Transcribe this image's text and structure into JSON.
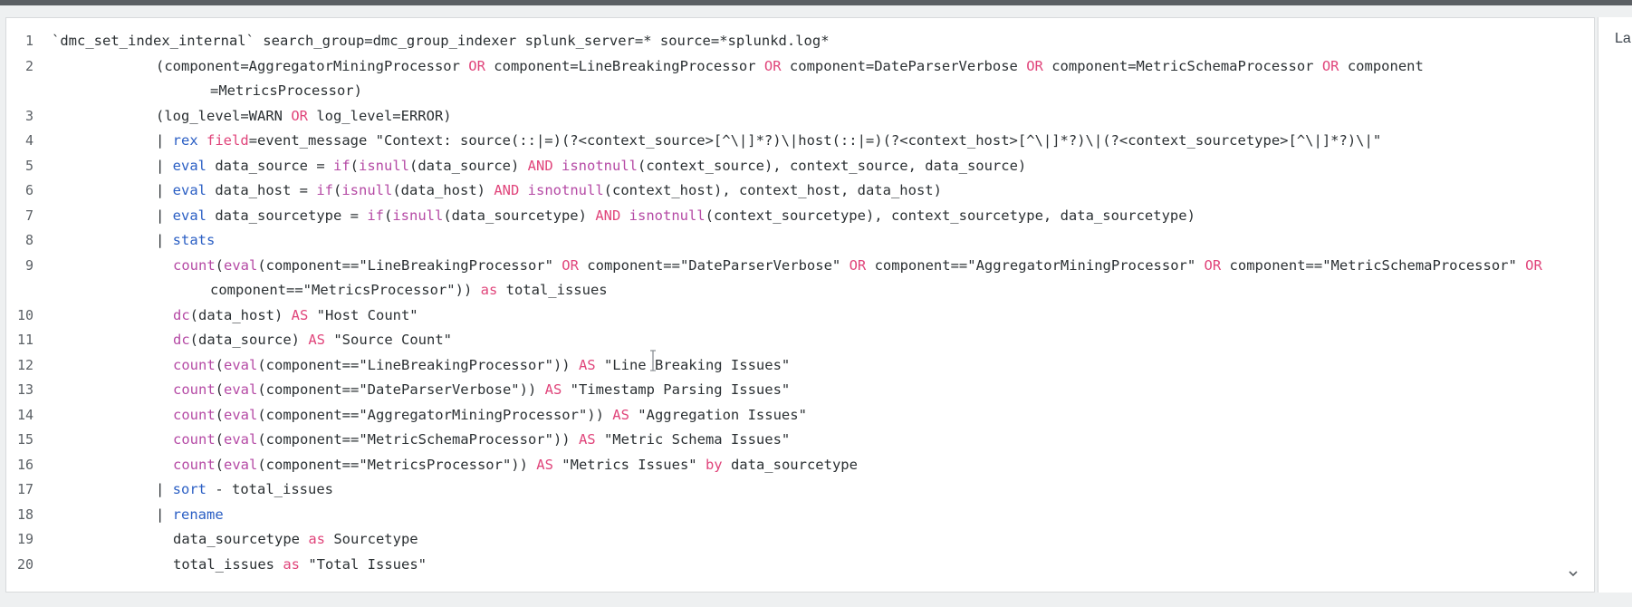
{
  "side_panel": {
    "label": "La"
  },
  "lines": [
    {
      "n": "1",
      "indent": 0,
      "wrap": false,
      "segs": [
        [
          "t",
          "`dmc_set_index_internal` search_group=dmc_group_indexer splunk_server=* source=*splunkd.log*"
        ]
      ]
    },
    {
      "n": "2",
      "indent": 1,
      "wrap": false,
      "segs": [
        [
          "t",
          "(component=AggregatorMiningProcessor "
        ],
        [
          "kw",
          "OR"
        ],
        [
          "t",
          " component=LineBreakingProcessor "
        ],
        [
          "kw",
          "OR"
        ],
        [
          "t",
          " component=DateParserVerbose "
        ],
        [
          "kw",
          "OR"
        ],
        [
          "t",
          " component=MetricSchemaProcessor "
        ],
        [
          "kw",
          "OR"
        ],
        [
          "t",
          " component"
        ]
      ]
    },
    {
      "n": "",
      "indent": 3,
      "wrap": true,
      "segs": [
        [
          "t",
          "=MetricsProcessor)"
        ]
      ]
    },
    {
      "n": "3",
      "indent": 1,
      "wrap": false,
      "segs": [
        [
          "t",
          "(log_level=WARN "
        ],
        [
          "kw",
          "OR"
        ],
        [
          "t",
          " log_level=ERROR)"
        ]
      ]
    },
    {
      "n": "4",
      "indent": 1,
      "wrap": false,
      "segs": [
        [
          "t",
          "| "
        ],
        [
          "cmd",
          "rex"
        ],
        [
          "t",
          " "
        ],
        [
          "kw",
          "field"
        ],
        [
          "t",
          "=event_message \"Context: source(::|=)(?<context_source>[^\\|]*?)\\|host(::|=)(?<context_host>[^\\|]*?)\\|(?<context_sourcetype>[^\\|]*?)\\|\""
        ]
      ]
    },
    {
      "n": "5",
      "indent": 1,
      "wrap": false,
      "segs": [
        [
          "t",
          "| "
        ],
        [
          "cmd",
          "eval"
        ],
        [
          "t",
          " data_source = "
        ],
        [
          "fn",
          "if"
        ],
        [
          "t",
          "("
        ],
        [
          "fn",
          "isnull"
        ],
        [
          "t",
          "(data_source) "
        ],
        [
          "kw",
          "AND"
        ],
        [
          "t",
          " "
        ],
        [
          "fn",
          "isnotnull"
        ],
        [
          "t",
          "(context_source), context_source, data_source)"
        ]
      ]
    },
    {
      "n": "6",
      "indent": 1,
      "wrap": false,
      "segs": [
        [
          "t",
          "| "
        ],
        [
          "cmd",
          "eval"
        ],
        [
          "t",
          " data_host = "
        ],
        [
          "fn",
          "if"
        ],
        [
          "t",
          "("
        ],
        [
          "fn",
          "isnull"
        ],
        [
          "t",
          "(data_host) "
        ],
        [
          "kw",
          "AND"
        ],
        [
          "t",
          " "
        ],
        [
          "fn",
          "isnotnull"
        ],
        [
          "t",
          "(context_host), context_host, data_host)"
        ]
      ]
    },
    {
      "n": "7",
      "indent": 1,
      "wrap": false,
      "segs": [
        [
          "t",
          "| "
        ],
        [
          "cmd",
          "eval"
        ],
        [
          "t",
          " data_sourcetype = "
        ],
        [
          "fn",
          "if"
        ],
        [
          "t",
          "("
        ],
        [
          "fn",
          "isnull"
        ],
        [
          "t",
          "(data_sourcetype) "
        ],
        [
          "kw",
          "AND"
        ],
        [
          "t",
          " "
        ],
        [
          "fn",
          "isnotnull"
        ],
        [
          "t",
          "(context_sourcetype), context_sourcetype, data_sourcetype)"
        ]
      ]
    },
    {
      "n": "8",
      "indent": 1,
      "wrap": false,
      "segs": [
        [
          "t",
          "| "
        ],
        [
          "cmd",
          "stats"
        ]
      ]
    },
    {
      "n": "9",
      "indent": 2,
      "wrap": false,
      "segs": [
        [
          "fn",
          "count"
        ],
        [
          "t",
          "("
        ],
        [
          "fn",
          "eval"
        ],
        [
          "t",
          "(component==\"LineBreakingProcessor\" "
        ],
        [
          "kw",
          "OR"
        ],
        [
          "t",
          " component==\"DateParserVerbose\" "
        ],
        [
          "kw",
          "OR"
        ],
        [
          "t",
          " component==\"AggregatorMiningProcessor\" "
        ],
        [
          "kw",
          "OR"
        ],
        [
          "t",
          " component==\"MetricSchemaProcessor\" "
        ],
        [
          "kw",
          "OR"
        ]
      ]
    },
    {
      "n": "",
      "indent": 3,
      "wrap": true,
      "segs": [
        [
          "t",
          "component==\"MetricsProcessor\")) "
        ],
        [
          "kw",
          "as"
        ],
        [
          "t",
          " total_issues"
        ]
      ]
    },
    {
      "n": "10",
      "indent": 2,
      "wrap": false,
      "segs": [
        [
          "fn",
          "dc"
        ],
        [
          "t",
          "(data_host) "
        ],
        [
          "kw",
          "AS"
        ],
        [
          "t",
          " \"Host Count\""
        ]
      ]
    },
    {
      "n": "11",
      "indent": 2,
      "wrap": false,
      "segs": [
        [
          "fn",
          "dc"
        ],
        [
          "t",
          "(data_source) "
        ],
        [
          "kw",
          "AS"
        ],
        [
          "t",
          " \"Source Count\""
        ]
      ]
    },
    {
      "n": "12",
      "indent": 2,
      "wrap": false,
      "segs": [
        [
          "fn",
          "count"
        ],
        [
          "t",
          "("
        ],
        [
          "fn",
          "eval"
        ],
        [
          "t",
          "(component==\"LineBreakingProcessor\")) "
        ],
        [
          "kw",
          "AS"
        ],
        [
          "t",
          " \"Line Breaking Issues\""
        ]
      ]
    },
    {
      "n": "13",
      "indent": 2,
      "wrap": false,
      "segs": [
        [
          "fn",
          "count"
        ],
        [
          "t",
          "("
        ],
        [
          "fn",
          "eval"
        ],
        [
          "t",
          "(component==\"DateParserVerbose\")) "
        ],
        [
          "kw",
          "AS"
        ],
        [
          "t",
          " \"Timestamp Parsing Issues\""
        ]
      ]
    },
    {
      "n": "14",
      "indent": 2,
      "wrap": false,
      "segs": [
        [
          "fn",
          "count"
        ],
        [
          "t",
          "("
        ],
        [
          "fn",
          "eval"
        ],
        [
          "t",
          "(component==\"AggregatorMiningProcessor\")) "
        ],
        [
          "kw",
          "AS"
        ],
        [
          "t",
          " \"Aggregation Issues\""
        ]
      ]
    },
    {
      "n": "15",
      "indent": 2,
      "wrap": false,
      "segs": [
        [
          "fn",
          "count"
        ],
        [
          "t",
          "("
        ],
        [
          "fn",
          "eval"
        ],
        [
          "t",
          "(component==\"MetricSchemaProcessor\")) "
        ],
        [
          "kw",
          "AS"
        ],
        [
          "t",
          " \"Metric Schema Issues\""
        ]
      ]
    },
    {
      "n": "16",
      "indent": 2,
      "wrap": false,
      "segs": [
        [
          "fn",
          "count"
        ],
        [
          "t",
          "("
        ],
        [
          "fn",
          "eval"
        ],
        [
          "t",
          "(component==\"MetricsProcessor\")) "
        ],
        [
          "kw",
          "AS"
        ],
        [
          "t",
          " \"Metrics Issues\" "
        ],
        [
          "kw",
          "by"
        ],
        [
          "t",
          " data_sourcetype"
        ]
      ]
    },
    {
      "n": "17",
      "indent": 1,
      "wrap": false,
      "segs": [
        [
          "t",
          "| "
        ],
        [
          "cmd",
          "sort"
        ],
        [
          "t",
          " - total_issues"
        ]
      ]
    },
    {
      "n": "18",
      "indent": 1,
      "wrap": false,
      "segs": [
        [
          "t",
          "| "
        ],
        [
          "cmd",
          "rename"
        ]
      ]
    },
    {
      "n": "19",
      "indent": 2,
      "wrap": false,
      "segs": [
        [
          "t",
          "data_sourcetype "
        ],
        [
          "kw",
          "as"
        ],
        [
          "t",
          " Sourcetype"
        ]
      ]
    },
    {
      "n": "20",
      "indent": 2,
      "wrap": false,
      "segs": [
        [
          "t",
          "total_issues "
        ],
        [
          "kw",
          "as"
        ],
        [
          "t",
          " \"Total Issues\""
        ]
      ]
    }
  ],
  "icons": {
    "collapse": "chevron-down-icon",
    "cursor": "text-cursor-icon"
  }
}
